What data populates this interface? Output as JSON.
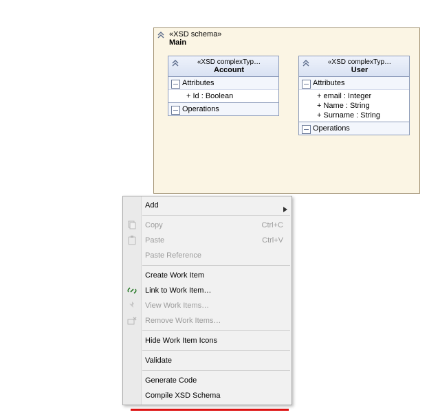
{
  "schema": {
    "stereo": "«XSD schema»",
    "name": "Main",
    "types": [
      {
        "stereo": "«XSD complexTyp…",
        "name": "Account",
        "attr_section": "Attributes",
        "attrs": [
          "+ Id : Boolean"
        ],
        "ops_section": "Operations"
      },
      {
        "stereo": "«XSD complexTyp…",
        "name": "User",
        "attr_section": "Attributes",
        "attrs": [
          "+ email : Integer",
          "+ Name : String",
          "+ Surname : String"
        ],
        "ops_section": "Operations"
      }
    ]
  },
  "menu": {
    "items": [
      {
        "label": "Add",
        "enabled": true,
        "submenu": true
      },
      {
        "sep": true
      },
      {
        "label": "Copy",
        "enabled": false,
        "shortcut": "Ctrl+C",
        "icon": "copy-icon"
      },
      {
        "label": "Paste",
        "enabled": false,
        "shortcut": "Ctrl+V",
        "icon": "paste-icon"
      },
      {
        "label": "Paste Reference",
        "enabled": false
      },
      {
        "sep": true
      },
      {
        "label": "Create Work Item",
        "enabled": true
      },
      {
        "label": "Link to Work Item…",
        "enabled": true,
        "icon": "link-icon"
      },
      {
        "label": "View Work Items…",
        "enabled": false,
        "icon": "pin-icon"
      },
      {
        "label": "Remove Work Items…",
        "enabled": false,
        "icon": "remove-wi-icon"
      },
      {
        "sep": true
      },
      {
        "label": "Hide Work Item Icons",
        "enabled": true
      },
      {
        "sep": true
      },
      {
        "label": "Validate",
        "enabled": true
      },
      {
        "sep": true
      },
      {
        "label": "Generate Code",
        "enabled": true
      },
      {
        "label": "Compile XSD Schema",
        "enabled": true
      }
    ]
  }
}
